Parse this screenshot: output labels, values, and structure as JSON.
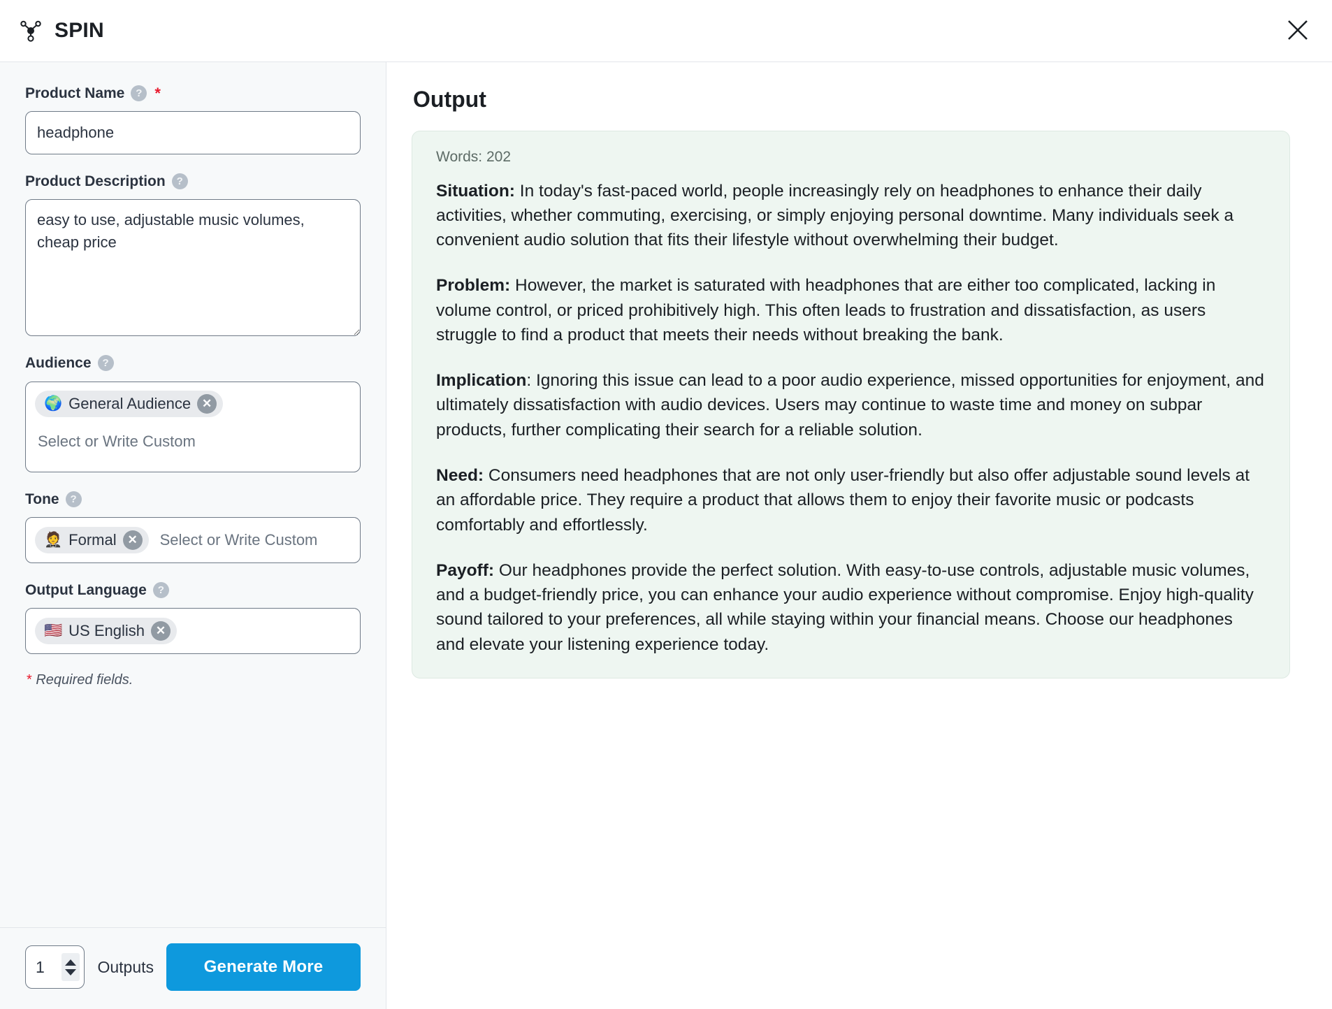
{
  "window": {
    "title": "SPIN",
    "brand_icon": "molecule-network-icon",
    "close_icon": "close-icon"
  },
  "form": {
    "product_name": {
      "label": "Product Name",
      "help_icon": "help-circle-icon",
      "required_marker": "*",
      "value": "headphone",
      "placeholder": ""
    },
    "product_description": {
      "label": "Product Description",
      "help_icon": "help-circle-icon",
      "value": "easy to use, adjustable music volumes, cheap price",
      "placeholder": ""
    },
    "audience": {
      "label": "Audience",
      "help_icon": "help-circle-icon",
      "placeholder": "Select or Write Custom",
      "chips": [
        {
          "emoji": "🌍",
          "label": "General Audience",
          "remove_icon": "remove-chip-icon"
        }
      ]
    },
    "tone": {
      "label": "Tone",
      "help_icon": "help-circle-icon",
      "placeholder": "Select or Write Custom",
      "chips": [
        {
          "emoji": "🤵",
          "label": "Formal",
          "remove_icon": "remove-chip-icon"
        }
      ]
    },
    "output_language": {
      "label": "Output Language",
      "help_icon": "help-circle-icon",
      "placeholder": "",
      "chips": [
        {
          "emoji": "🇺🇸",
          "label": "US English",
          "remove_icon": "remove-chip-icon"
        }
      ]
    },
    "required_note_star": "*",
    "required_note": " Required fields."
  },
  "footer": {
    "outputs_count": "1",
    "outputs_label": "Outputs",
    "generate_label": "Generate More",
    "generate_color": "#0e99dd",
    "stepper_up_icon": "chevron-up-icon",
    "stepper_down_icon": "chevron-down-icon"
  },
  "output": {
    "title": "Output",
    "word_count": "Words: 202",
    "card_background": "#eef6f1",
    "paragraphs": [
      {
        "heading": "Situation:",
        "text": " In today's fast-paced world, people increasingly rely on headphones to enhance their daily activities, whether commuting, exercising, or simply enjoying personal downtime. Many individuals seek a convenient audio solution that fits their lifestyle without overwhelming their budget."
      },
      {
        "heading": "Problem:",
        "text": " However, the market is saturated with headphones that are either too complicated, lacking in volume control, or priced prohibitively high. This often leads to frustration and dissatisfaction, as users struggle to find a product that meets their needs without breaking the bank."
      },
      {
        "heading": "Implication",
        "text": ": Ignoring this issue can lead to a poor audio experience, missed opportunities for enjoyment, and ultimately dissatisfaction with audio devices. Users may continue to waste time and money on subpar products, further complicating their search for a reliable solution."
      },
      {
        "heading": "Need:",
        "text": " Consumers need headphones that are not only user-friendly but also offer adjustable sound levels at an affordable price. They require a product that allows them to enjoy their favorite music or podcasts comfortably and effortlessly."
      },
      {
        "heading": "Payoff:",
        "text": " Our headphones provide the perfect solution. With easy-to-use controls, adjustable music volumes, and a budget-friendly price, you can enhance your audio experience without compromise. Enjoy high-quality sound tailored to your preferences, all while staying within your financial means. Choose our headphones and elevate your listening experience today."
      }
    ]
  }
}
